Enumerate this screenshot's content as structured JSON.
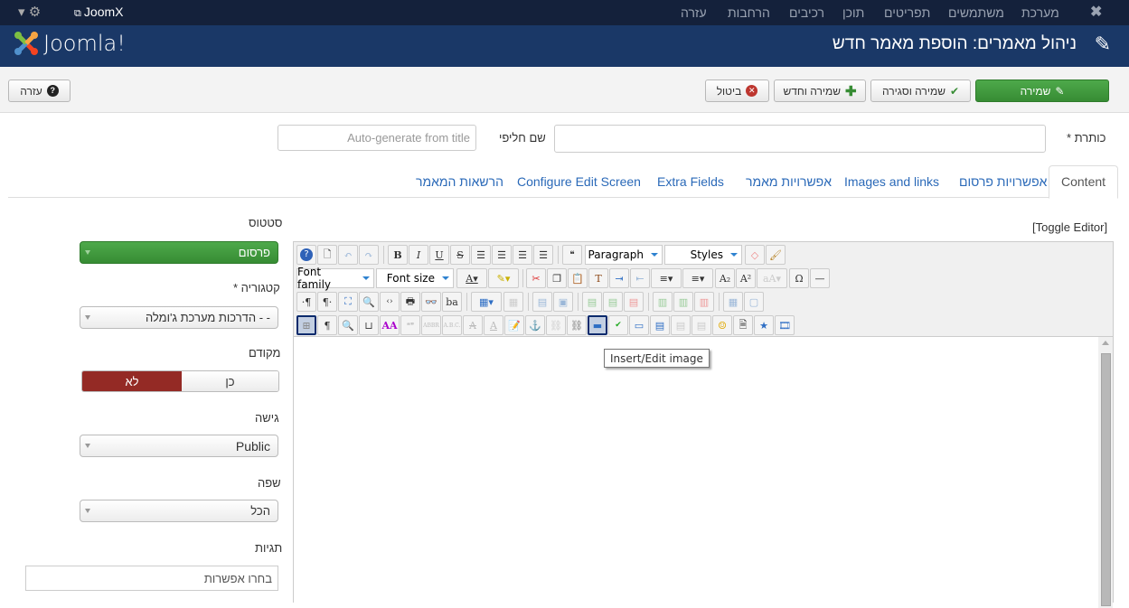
{
  "topnav": {
    "site_link": "JoomX",
    "menu": [
      "מערכת",
      "משתמשים",
      "תפריטים",
      "תוכן",
      "רכיבים",
      "הרחבות",
      "עזרה"
    ]
  },
  "header": {
    "logo_text": "Joomla!",
    "title": "ניהול מאמרים: הוספת מאמר חדש"
  },
  "toolbar": {
    "save": "שמירה",
    "save_close": "שמירה וסגירה",
    "save_new": "שמירה וחדש",
    "cancel": "ביטול",
    "help": "עזרה"
  },
  "form": {
    "title_label": "כותרת *",
    "title_value": "",
    "alias_label": "שם חליפי",
    "alias_placeholder": "Auto-generate from title"
  },
  "tabs": [
    {
      "label": "Content",
      "active": true
    },
    {
      "label": "אפשרויות פרסום"
    },
    {
      "label": "Images and links"
    },
    {
      "label": "אפשרויות מאמר"
    },
    {
      "label": "Extra Fields"
    },
    {
      "label": "Configure Edit Screen"
    },
    {
      "label": "הרשאות המאמר"
    }
  ],
  "editor": {
    "toggle": "[Toggle Editor]",
    "paragraph": "Paragraph",
    "styles": "Styles",
    "font_family": "Font family",
    "font_size": "Font size",
    "tooltip": "Insert/Edit image"
  },
  "sidebar": {
    "status_label": "סטטוס",
    "status_value": "פרסום",
    "category_label": "קטגוריה *",
    "category_value": "- - הדרכות מערכת ג'ומלה",
    "featured_label": "מקודם",
    "featured_yes": "כן",
    "featured_no": "לא",
    "featured_selected": "לא",
    "access_label": "גישה",
    "access_value": "Public",
    "language_label": "שפה",
    "language_value": "הכל",
    "tags_label": "תגיות",
    "tags_placeholder": "בחרו אפשרות"
  },
  "colors": {
    "topnav_bg": "#14213b",
    "header_bg": "#1a3867",
    "save_green": "#3f9a3c",
    "featured_no_red": "#942a25",
    "link_blue": "#2a69b8"
  }
}
